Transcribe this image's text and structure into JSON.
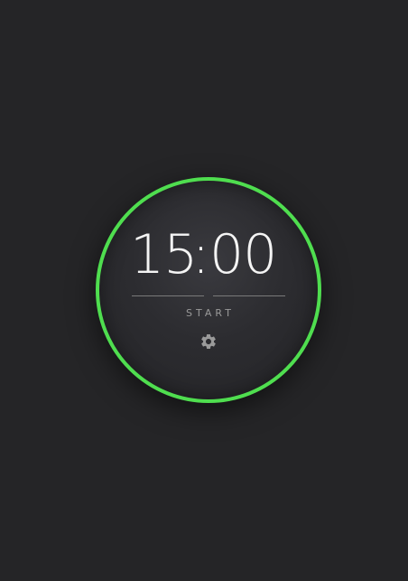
{
  "timer": {
    "minutes": "15",
    "separator": ":",
    "seconds": "00",
    "start_label": "START",
    "settings_icon": "gear-icon",
    "ring_color": "#4fde4f",
    "background_color": "#252527"
  }
}
